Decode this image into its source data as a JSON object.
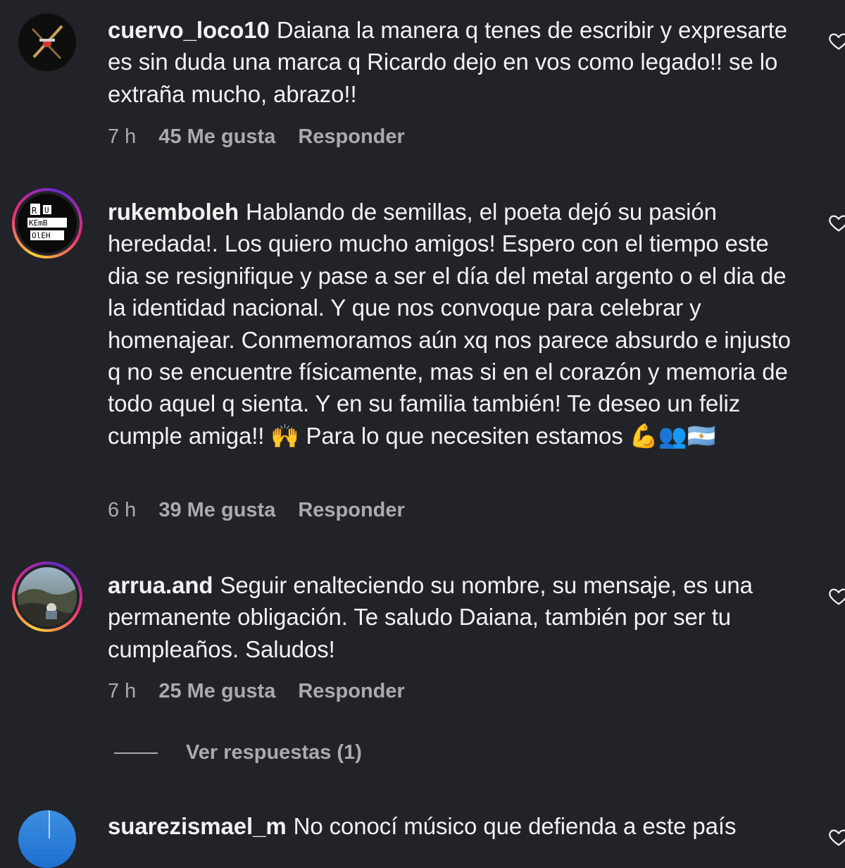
{
  "comments": [
    {
      "username": "cuervo_loco10",
      "text": "Daiana la manera q tenes de escribir y expresarte es sin duda una marca q Ricardo dejo en vos como legado!! se lo extraña mucho, abrazo!!",
      "time": "7 h",
      "likes": "45 Me gusta",
      "reply": "Responder"
    },
    {
      "username": "rukemboleh",
      "text": "Hablando de semillas, el poeta dejó su pasión heredada!. Los quiero mucho amigos! Espero con el tiempo este dia se resignifique y pase a ser el día del metal argento o el dia de la identidad nacional. Y que nos convoque para celebrar y homenajear. Conmemoramos aún xq nos parece absurdo e injusto q no se encuentre físicamente, mas si en el corazón y memoria de todo aquel q sienta. Y en su familia también! Te deseo un feliz cumple amiga!! 🙌 Para lo que necesiten estamos 💪👥🇦🇷",
      "time": "6 h",
      "likes": "39 Me gusta",
      "reply": "Responder",
      "avatar_text": "RU KEMB OLEH"
    },
    {
      "username": "arrua.and",
      "text": "Seguir enalteciendo su nombre, su mensaje, es una permanente obligación. Te saludo Daiana, también por ser tu cumpleaños. Saludos!",
      "time": "7 h",
      "likes": "25 Me gusta",
      "reply": "Responder"
    },
    {
      "username": "suarezismael_m",
      "text": "No conocí músico que defienda a este país"
    }
  ],
  "view_replies": "Ver respuestas (1)",
  "icons": {
    "like": "heart-outline-icon"
  },
  "colors": {
    "background": "#212328",
    "text": "#f2f2f2",
    "muted": "#a9abb0"
  }
}
